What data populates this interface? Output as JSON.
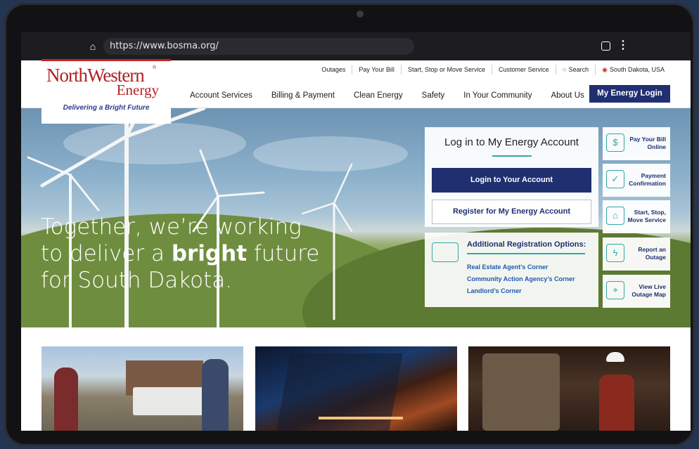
{
  "browser": {
    "url": "https://www.bosma.org/",
    "home_icon": "home-icon",
    "tabs_icon": "tabs-icon",
    "menu_glyph": "⋮"
  },
  "utility_nav": [
    "Outages",
    "Pay Your Bill",
    "Start, Stop or Move Service",
    "Customer Service"
  ],
  "search_label": "Search",
  "location_label": "South Dakota, USA",
  "logo": {
    "main": "NorthWestern",
    "reg": "®",
    "sub": "Energy",
    "tagline": "Delivering a Bright Future"
  },
  "main_nav": [
    "Account Services",
    "Billing & Payment",
    "Clean Energy",
    "Safety",
    "In Your Community",
    "About Us"
  ],
  "login_button": "My Energy Login",
  "hero": {
    "line1": "Together, we’re working",
    "line2_pre": "to deliver a ",
    "line2_bold": "bright",
    "line2_post": " future",
    "line3": "for South Dakota."
  },
  "login_card": {
    "title": "Log in to My Energy Account",
    "login_label": "Login to Your Account",
    "register_label": "Register for My Energy Account"
  },
  "registration": {
    "title": "Additional Registration Options:",
    "links": [
      "Real Estate Agent’s Corner",
      "Community Action Agency’s Corner",
      "Landlord’s Corner"
    ]
  },
  "tiles": [
    {
      "label": "Pay Your Bill Online",
      "icon": "bill-icon"
    },
    {
      "label": "Payment Confirmation",
      "icon": "monitor-check-icon"
    },
    {
      "label": "Start, Stop, Move Service",
      "icon": "house-gear-icon"
    },
    {
      "label": "Report an Outage",
      "icon": "lightning-icon"
    },
    {
      "label": "View Live Outage Map",
      "icon": "map-pin-icon"
    }
  ],
  "colors": {
    "brand_red": "#b32124",
    "navy": "#1f2f70",
    "teal": "#2fa8a8"
  }
}
